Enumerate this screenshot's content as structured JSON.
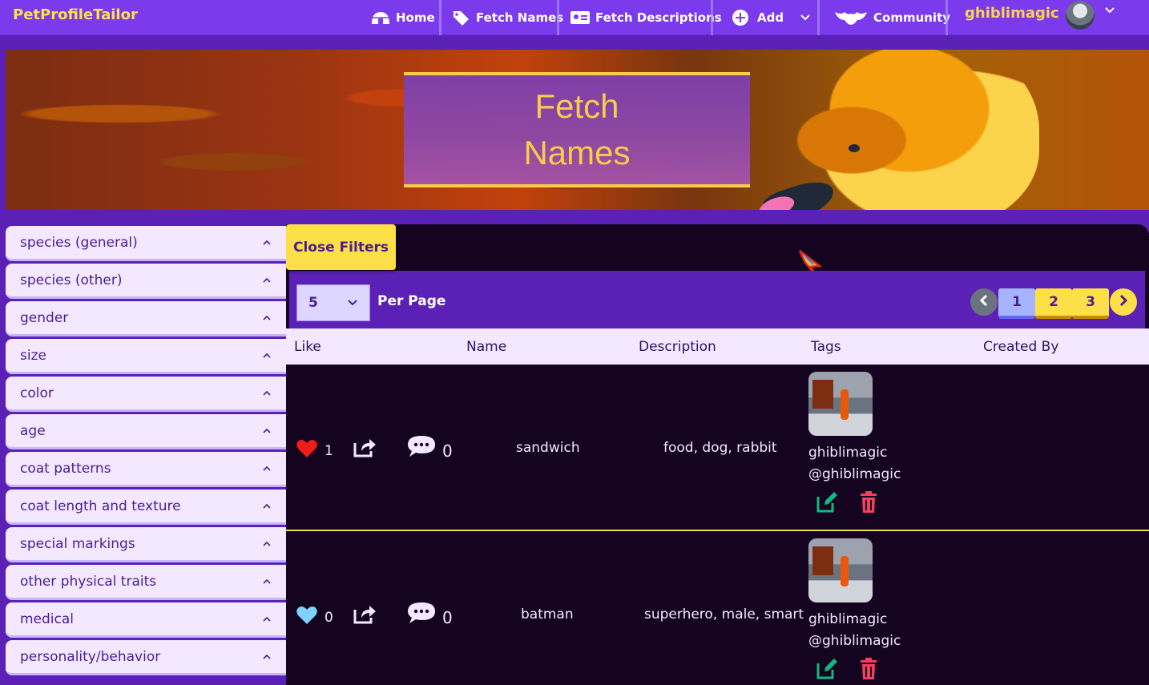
{
  "navbar": {
    "brand": "PetProfileTailor",
    "items": [
      {
        "label": "Home",
        "icon": "igloo-icon"
      },
      {
        "label": "Fetch Names",
        "icon": "tags-icon"
      },
      {
        "label": "Fetch Descriptions",
        "icon": "id-card-icon"
      },
      {
        "label": "Add",
        "icon": "plus-circle-icon"
      },
      {
        "label": "Community",
        "icon": "bat-icon"
      }
    ],
    "username": "ghiblimagic"
  },
  "banner": {
    "title_line1": "Fetch",
    "title_line2": "Names"
  },
  "filters": [
    "species (general)",
    "species (other)",
    "gender",
    "size",
    "color",
    "age",
    "coat patterns",
    "coat length and texture",
    "special markings",
    "other physical traits",
    "medical",
    "personality/behavior"
  ],
  "main": {
    "close_filters_label": "Close Filters",
    "per_page_value": "5",
    "per_page_label": "Per Page",
    "pages": [
      "1",
      "2",
      "3"
    ],
    "active_page": "1",
    "columns": [
      "Like",
      "Name",
      "Description",
      "Tags",
      "Created By"
    ]
  },
  "rows": [
    {
      "liked": true,
      "like_count": "1",
      "comment_count": "0",
      "name": "sandwich",
      "tags": "food, dog, rabbit",
      "creator_name": "ghiblimagic",
      "creator_handle": "@ghiblimagic"
    },
    {
      "liked": false,
      "like_count": "0",
      "comment_count": "0",
      "name": "batman",
      "tags": "superhero, male, smart",
      "creator_name": "ghiblimagic",
      "creator_handle": "@ghiblimagic"
    }
  ],
  "colors": {
    "nav_bg": "#7c3aed",
    "accent_yellow": "#fde047",
    "panel_dark": "#14041f",
    "heart_red": "#ef1c1c",
    "heart_blue": "#7dd3fc",
    "edit_green": "#10b981",
    "delete_red": "#f43f5e"
  }
}
